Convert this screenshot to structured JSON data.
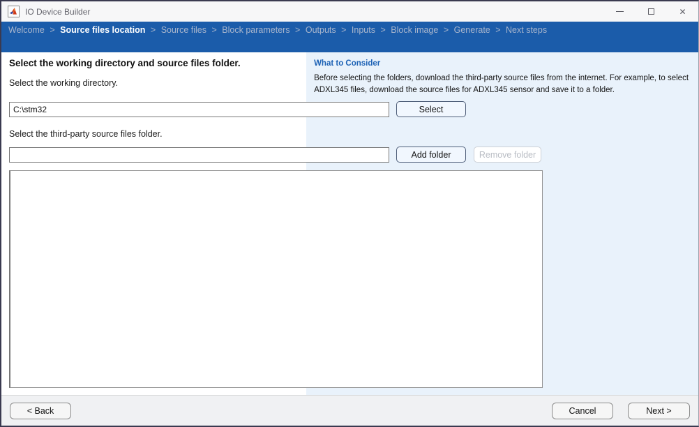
{
  "window": {
    "title": "IO Device Builder"
  },
  "breadcrumb": {
    "separator": ">",
    "active_index": 1,
    "items": [
      {
        "label": "Welcome"
      },
      {
        "label": "Source files location"
      },
      {
        "label": "Source files"
      },
      {
        "label": "Block parameters"
      },
      {
        "label": "Outputs"
      },
      {
        "label": "Inputs"
      },
      {
        "label": "Block image"
      },
      {
        "label": "Generate"
      },
      {
        "label": "Next steps"
      }
    ]
  },
  "content": {
    "heading": "Select the working directory and source files folder.",
    "working_dir": {
      "label": "Select the working directory.",
      "value": "C:\\stm32",
      "select_button": "Select"
    },
    "source_folder": {
      "label": "Select the third-party source files folder.",
      "value": "",
      "add_button": "Add folder",
      "remove_button": "Remove folder"
    }
  },
  "sidebar": {
    "heading": "What to Consider",
    "body": "Before selecting the folders, download the third-party source files from the internet. For example, to select ADXL345 files,  download the source files for ADXL345 sensor and save it to a folder."
  },
  "footer": {
    "back_button": "< Back",
    "cancel_button": "Cancel",
    "next_button": "Next >"
  },
  "colors": {
    "breadcrumb_bg": "#1b5caa",
    "breadcrumb_inactive": "#a9b6cd",
    "breadcrumb_active": "#ffffff",
    "sidebar_bg": "#e9f2fb",
    "accent_blue": "#1d62b5",
    "button_blue_bg": "#f1f7fe",
    "button_blue_border": "#4d5d78",
    "disabled_text": "#b9bdc4",
    "footer_bg": "#f0f1f3"
  }
}
